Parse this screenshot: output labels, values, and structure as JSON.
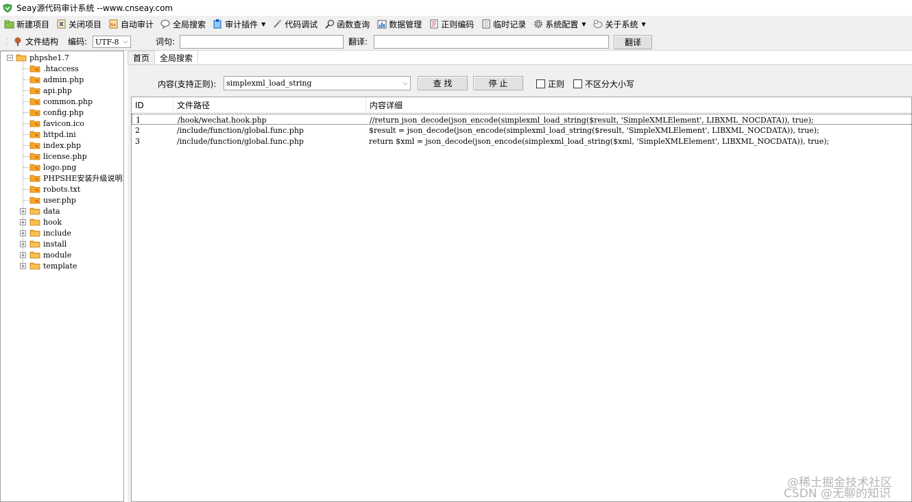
{
  "window": {
    "title": "Seay源代码审计系统 --www.cnseay.com"
  },
  "menu": [
    {
      "label": "新建项目",
      "icon": "new-project-icon"
    },
    {
      "label": "关闭项目",
      "icon": "close-project-icon"
    },
    {
      "label": "自动审计",
      "icon": "auto-audit-icon"
    },
    {
      "label": "全局搜索",
      "icon": "global-search-icon"
    },
    {
      "label": "审计插件",
      "icon": "plugin-icon",
      "dropdown": true
    },
    {
      "label": "代码调试",
      "icon": "debug-icon"
    },
    {
      "label": "函数查询",
      "icon": "function-search-icon"
    },
    {
      "label": "数据管理",
      "icon": "data-management-icon"
    },
    {
      "label": "正则编码",
      "icon": "regex-encode-icon"
    },
    {
      "label": "临时记录",
      "icon": "temp-record-icon"
    },
    {
      "label": "系统配置",
      "icon": "gear-icon",
      "dropdown": true
    },
    {
      "label": "关于系统",
      "icon": "about-icon",
      "dropdown": true
    }
  ],
  "toolbar": {
    "file_tree_label": "文件结构",
    "encoding_label": "编码:",
    "encoding_value": "UTF-8",
    "word_label": "词句:",
    "word_value": "",
    "translate_label": "翻译:",
    "translate_value": "",
    "translate_button": "翻译"
  },
  "tree": {
    "root": "phpshe1.7",
    "files": [
      ".htaccess",
      "admin.php",
      "api.php",
      "common.php",
      "config.php",
      "favicon.ico",
      "httpd.ini",
      "index.php",
      "license.php",
      "logo.png",
      "PHPSHE安装升级说明.",
      "robots.txt",
      "user.php"
    ],
    "folders": [
      "data",
      "hook",
      "include",
      "install",
      "module",
      "template"
    ]
  },
  "tabs": [
    {
      "label": "首页",
      "active": false
    },
    {
      "label": "全局搜索",
      "active": true
    }
  ],
  "search": {
    "content_label": "内容(支持正则):",
    "content_value": "simplexml_load_string",
    "find_button": "查 找",
    "stop_button": "停 止",
    "regex_label": "正则",
    "regex_checked": false,
    "ignore_case_label": "不区分大小写",
    "ignore_case_checked": false
  },
  "results": {
    "columns": [
      "ID",
      "文件路径",
      "内容详细"
    ],
    "rows": [
      {
        "id": "1",
        "path": "/hook/wechat.hook.php",
        "detail": "//return json_decode(json_encode(simplexml_load_string($result, 'SimpleXMLElement', LIBXML_NOCDATA)), true);"
      },
      {
        "id": "2",
        "path": "/include/function/global.func.php",
        "detail": "$result = json_decode(json_encode(simplexml_load_string($result, 'SimpleXMLElement', LIBXML_NOCDATA)), true);"
      },
      {
        "id": "3",
        "path": "/include/function/global.func.php",
        "detail": "return $xml = json_decode(json_encode(simplexml_load_string($xml, 'SimpleXMLElement', LIBXML_NOCDATA)), true);"
      }
    ]
  },
  "watermark": {
    "line1": "@稀土掘金技术社区",
    "line2": "CSDN @无聊的知识"
  }
}
